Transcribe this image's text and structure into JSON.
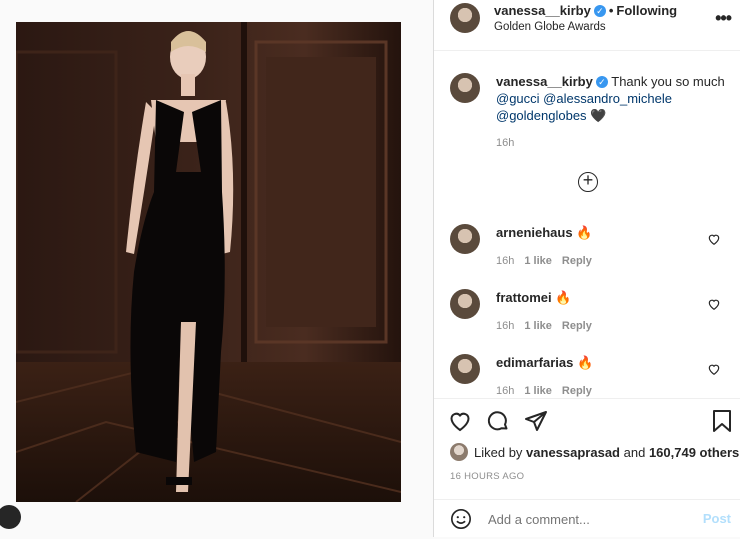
{
  "post": {
    "username": "vanessa__kirby",
    "follow_status": "Following",
    "location": "Golden Globe Awards",
    "caption_text": "Thank you so much",
    "caption_mentions": [
      "@gucci",
      "@alessandro_michele",
      "@goldenglobes"
    ],
    "caption_emoji": "🖤",
    "caption_time": "16h"
  },
  "comments": [
    {
      "username": "arneniehaus",
      "emoji": "🔥",
      "time": "16h",
      "likes": "1 like",
      "reply": "Reply"
    },
    {
      "username": "frattomei",
      "emoji": "🔥",
      "time": "16h",
      "likes": "1 like",
      "reply": "Reply"
    },
    {
      "username": "edimarfarias",
      "emoji": "🔥",
      "time": "16h",
      "likes": "1 like",
      "reply": "Reply"
    }
  ],
  "likes": {
    "prefix": "Liked by",
    "user": "vanessaprasad",
    "conj": "and",
    "others": "160,749 others"
  },
  "posted_ago": "16 HOURS AGO",
  "comment_box": {
    "placeholder": "Add a comment...",
    "post_label": "Post"
  },
  "icons": {
    "verified": "verified-badge-icon",
    "more": "more-options-icon",
    "load_more": "plus-circle-icon",
    "like": "heart-icon",
    "comment": "comment-bubble-icon",
    "share": "paper-plane-icon",
    "save": "bookmark-icon",
    "emoji": "smiley-icon"
  },
  "colors": {
    "link": "#00376b",
    "verified": "#3897f0",
    "muted": "#8e8e8e",
    "post_disabled": "#b2dffc"
  }
}
